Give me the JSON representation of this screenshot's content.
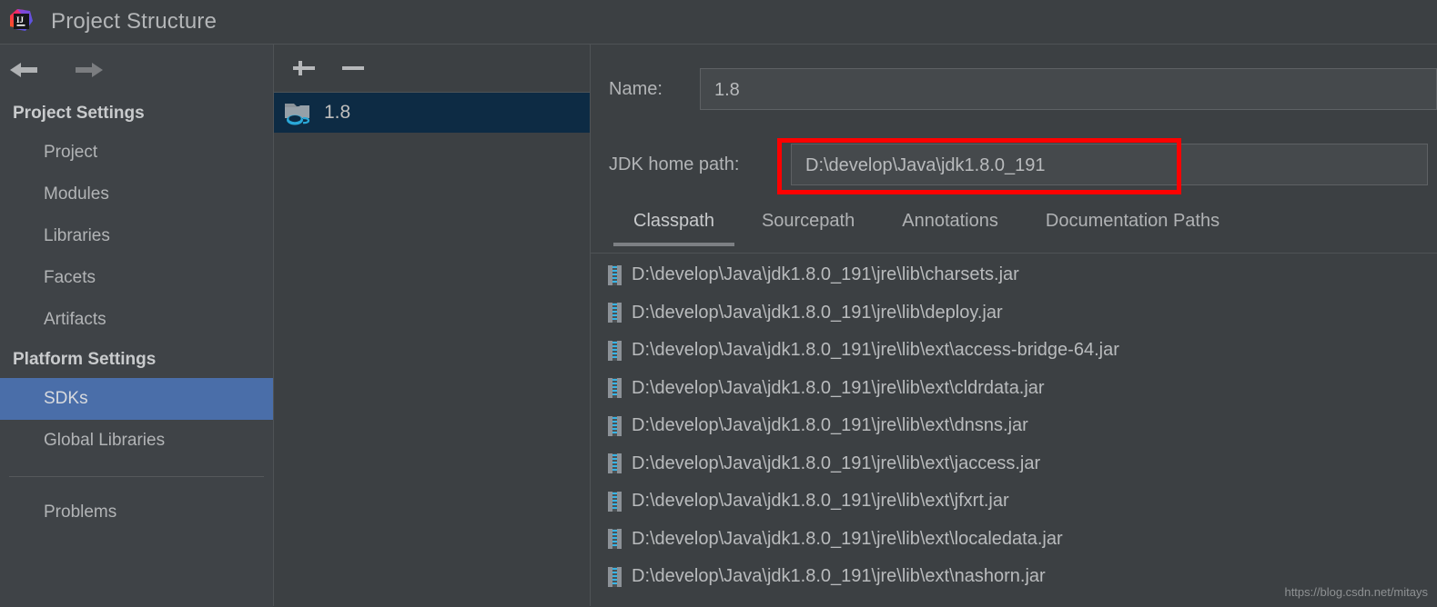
{
  "window": {
    "title": "Project Structure",
    "logo_icon": "intellij-idea-logo"
  },
  "nav": {
    "back_icon": "arrow-left-icon",
    "forward_icon": "arrow-right-icon"
  },
  "sidebar": {
    "groups": [
      {
        "title": "Project Settings",
        "items": [
          {
            "label": "Project",
            "selected": false
          },
          {
            "label": "Modules",
            "selected": false
          },
          {
            "label": "Libraries",
            "selected": false
          },
          {
            "label": "Facets",
            "selected": false
          },
          {
            "label": "Artifacts",
            "selected": false
          }
        ]
      },
      {
        "title": "Platform Settings",
        "items": [
          {
            "label": "SDKs",
            "selected": true
          },
          {
            "label": "Global Libraries",
            "selected": false
          }
        ]
      }
    ],
    "footer_items": [
      {
        "label": "Problems"
      }
    ],
    "selected_color": "#4a6ea9"
  },
  "sdk_panel": {
    "toolbar": {
      "add_label": "+",
      "add_icon": "plus-icon",
      "remove_label": "−",
      "remove_icon": "minus-icon"
    },
    "items": [
      {
        "label": "1.8",
        "icon": "jdk-folder-icon",
        "selected": true
      }
    ],
    "selected_row_color": "#0d2b44"
  },
  "detail": {
    "name_label": "Name:",
    "name_value": "1.8",
    "jdk_home_label": "JDK home path:",
    "jdk_home_value": "D:\\develop\\Java\\jdk1.8.0_191",
    "highlight_color": "#fe0000",
    "tabs": [
      {
        "label": "Classpath",
        "active": true
      },
      {
        "label": "Sourcepath",
        "active": false
      },
      {
        "label": "Annotations",
        "active": false
      },
      {
        "label": "Documentation Paths",
        "active": false
      }
    ],
    "classpath_entries": [
      {
        "icon": "jar-icon",
        "path": "D:\\develop\\Java\\jdk1.8.0_191\\jre\\lib\\charsets.jar"
      },
      {
        "icon": "jar-icon",
        "path": "D:\\develop\\Java\\jdk1.8.0_191\\jre\\lib\\deploy.jar"
      },
      {
        "icon": "jar-icon",
        "path": "D:\\develop\\Java\\jdk1.8.0_191\\jre\\lib\\ext\\access-bridge-64.jar"
      },
      {
        "icon": "jar-icon",
        "path": "D:\\develop\\Java\\jdk1.8.0_191\\jre\\lib\\ext\\cldrdata.jar"
      },
      {
        "icon": "jar-icon",
        "path": "D:\\develop\\Java\\jdk1.8.0_191\\jre\\lib\\ext\\dnsns.jar"
      },
      {
        "icon": "jar-icon",
        "path": "D:\\develop\\Java\\jdk1.8.0_191\\jre\\lib\\ext\\jaccess.jar"
      },
      {
        "icon": "jar-icon",
        "path": "D:\\develop\\Java\\jdk1.8.0_191\\jre\\lib\\ext\\jfxrt.jar"
      },
      {
        "icon": "jar-icon",
        "path": "D:\\develop\\Java\\jdk1.8.0_191\\jre\\lib\\ext\\localedata.jar"
      },
      {
        "icon": "jar-icon",
        "path": "D:\\develop\\Java\\jdk1.8.0_191\\jre\\lib\\ext\\nashorn.jar"
      }
    ]
  },
  "watermark": {
    "text": "https://blog.csdn.net/mitays"
  }
}
